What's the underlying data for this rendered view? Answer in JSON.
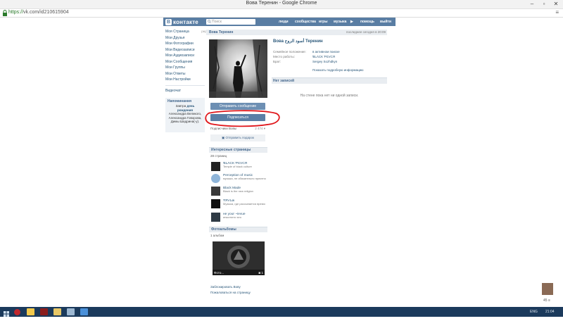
{
  "window": {
    "title": "Вова Теренин - Google Chrome"
  },
  "browser": {
    "url_scheme": "https://",
    "url_rest": "vk.com/id210615904"
  },
  "header": {
    "brand": "контакте",
    "brand_letter": "В",
    "search_placeholder": "Поиск",
    "nav": [
      "люди",
      "сообщества",
      "игры",
      "музыка",
      "помощь",
      "выйти"
    ]
  },
  "sidebar": {
    "items": [
      "Моя Страница",
      "Мои Друзья",
      "Мои Фотографии",
      "Мои Видеозаписи",
      "Мои Аудиозаписи",
      "Мои Сообщения",
      "Мои Группы",
      "Мои Ответы",
      "Мои Настройки"
    ],
    "edit_label": "ред.",
    "extra_item": "Видеочат",
    "reminder": {
      "heading": "Напоминания",
      "line1": "Завтра",
      "line1_bold": "день рождения",
      "body": "Александра Великого, Александра Говорова, Димы Шадрина(-у)."
    }
  },
  "profile": {
    "header_name": "Вова Теренин",
    "online_status": "последнее сегодня в 20:09",
    "send_message": "Отправить сообщение",
    "subscribe": "Подписаться",
    "subscribers_label": "Подписчики Вовы",
    "subscribers_count": "2 474",
    "gift": "Отправить подарок",
    "interesting_heading": "Интересные страницы",
    "interesting_count": "28 страниц",
    "pages": [
      {
        "name": "ƁLΛCK ƤƐVCЯ",
        "desc": "Temple of black culture"
      },
      {
        "name": "Perception of music",
        "desc": "музыка, не обязательно приятно"
      },
      {
        "name": "Black Made",
        "desc": "Black is the new religion"
      },
      {
        "name": "ŦЯVLøι",
        "desc": "Музыка, где рассыпается время"
      },
      {
        "name": "не your ~ievue",
        "desc": "инкогнито seu"
      }
    ],
    "albums_heading": "Фотоальбомы",
    "albums_count": "1 альбом",
    "album_caption": "Фото...",
    "album_photos": "1",
    "block_user": "Заблокировать Вову",
    "report_page": "Пожаловаться на страницу"
  },
  "info": {
    "name": "Вова أسود الروح Теренин",
    "rows": [
      {
        "label": "Семейное положение:",
        "value": "в активном поиске"
      },
      {
        "label": "Место работы:",
        "value": "ƁLΛCK ƤƐVCЯ"
      },
      {
        "label": "Брат:",
        "value": "Sergey Sozhdkyn"
      }
    ],
    "show_more": "Показать подробную информацию",
    "wall_heading": "Нет записей",
    "wall_empty": "На стене пока нет ни одной записи."
  },
  "chat": {
    "label": "45 ≡"
  },
  "taskbar": {
    "lang": "ENG",
    "time": "21:04"
  },
  "colors": {
    "vk_blue": "#597da3",
    "link": "#2b587a",
    "annotation_red": "#e0161b"
  }
}
